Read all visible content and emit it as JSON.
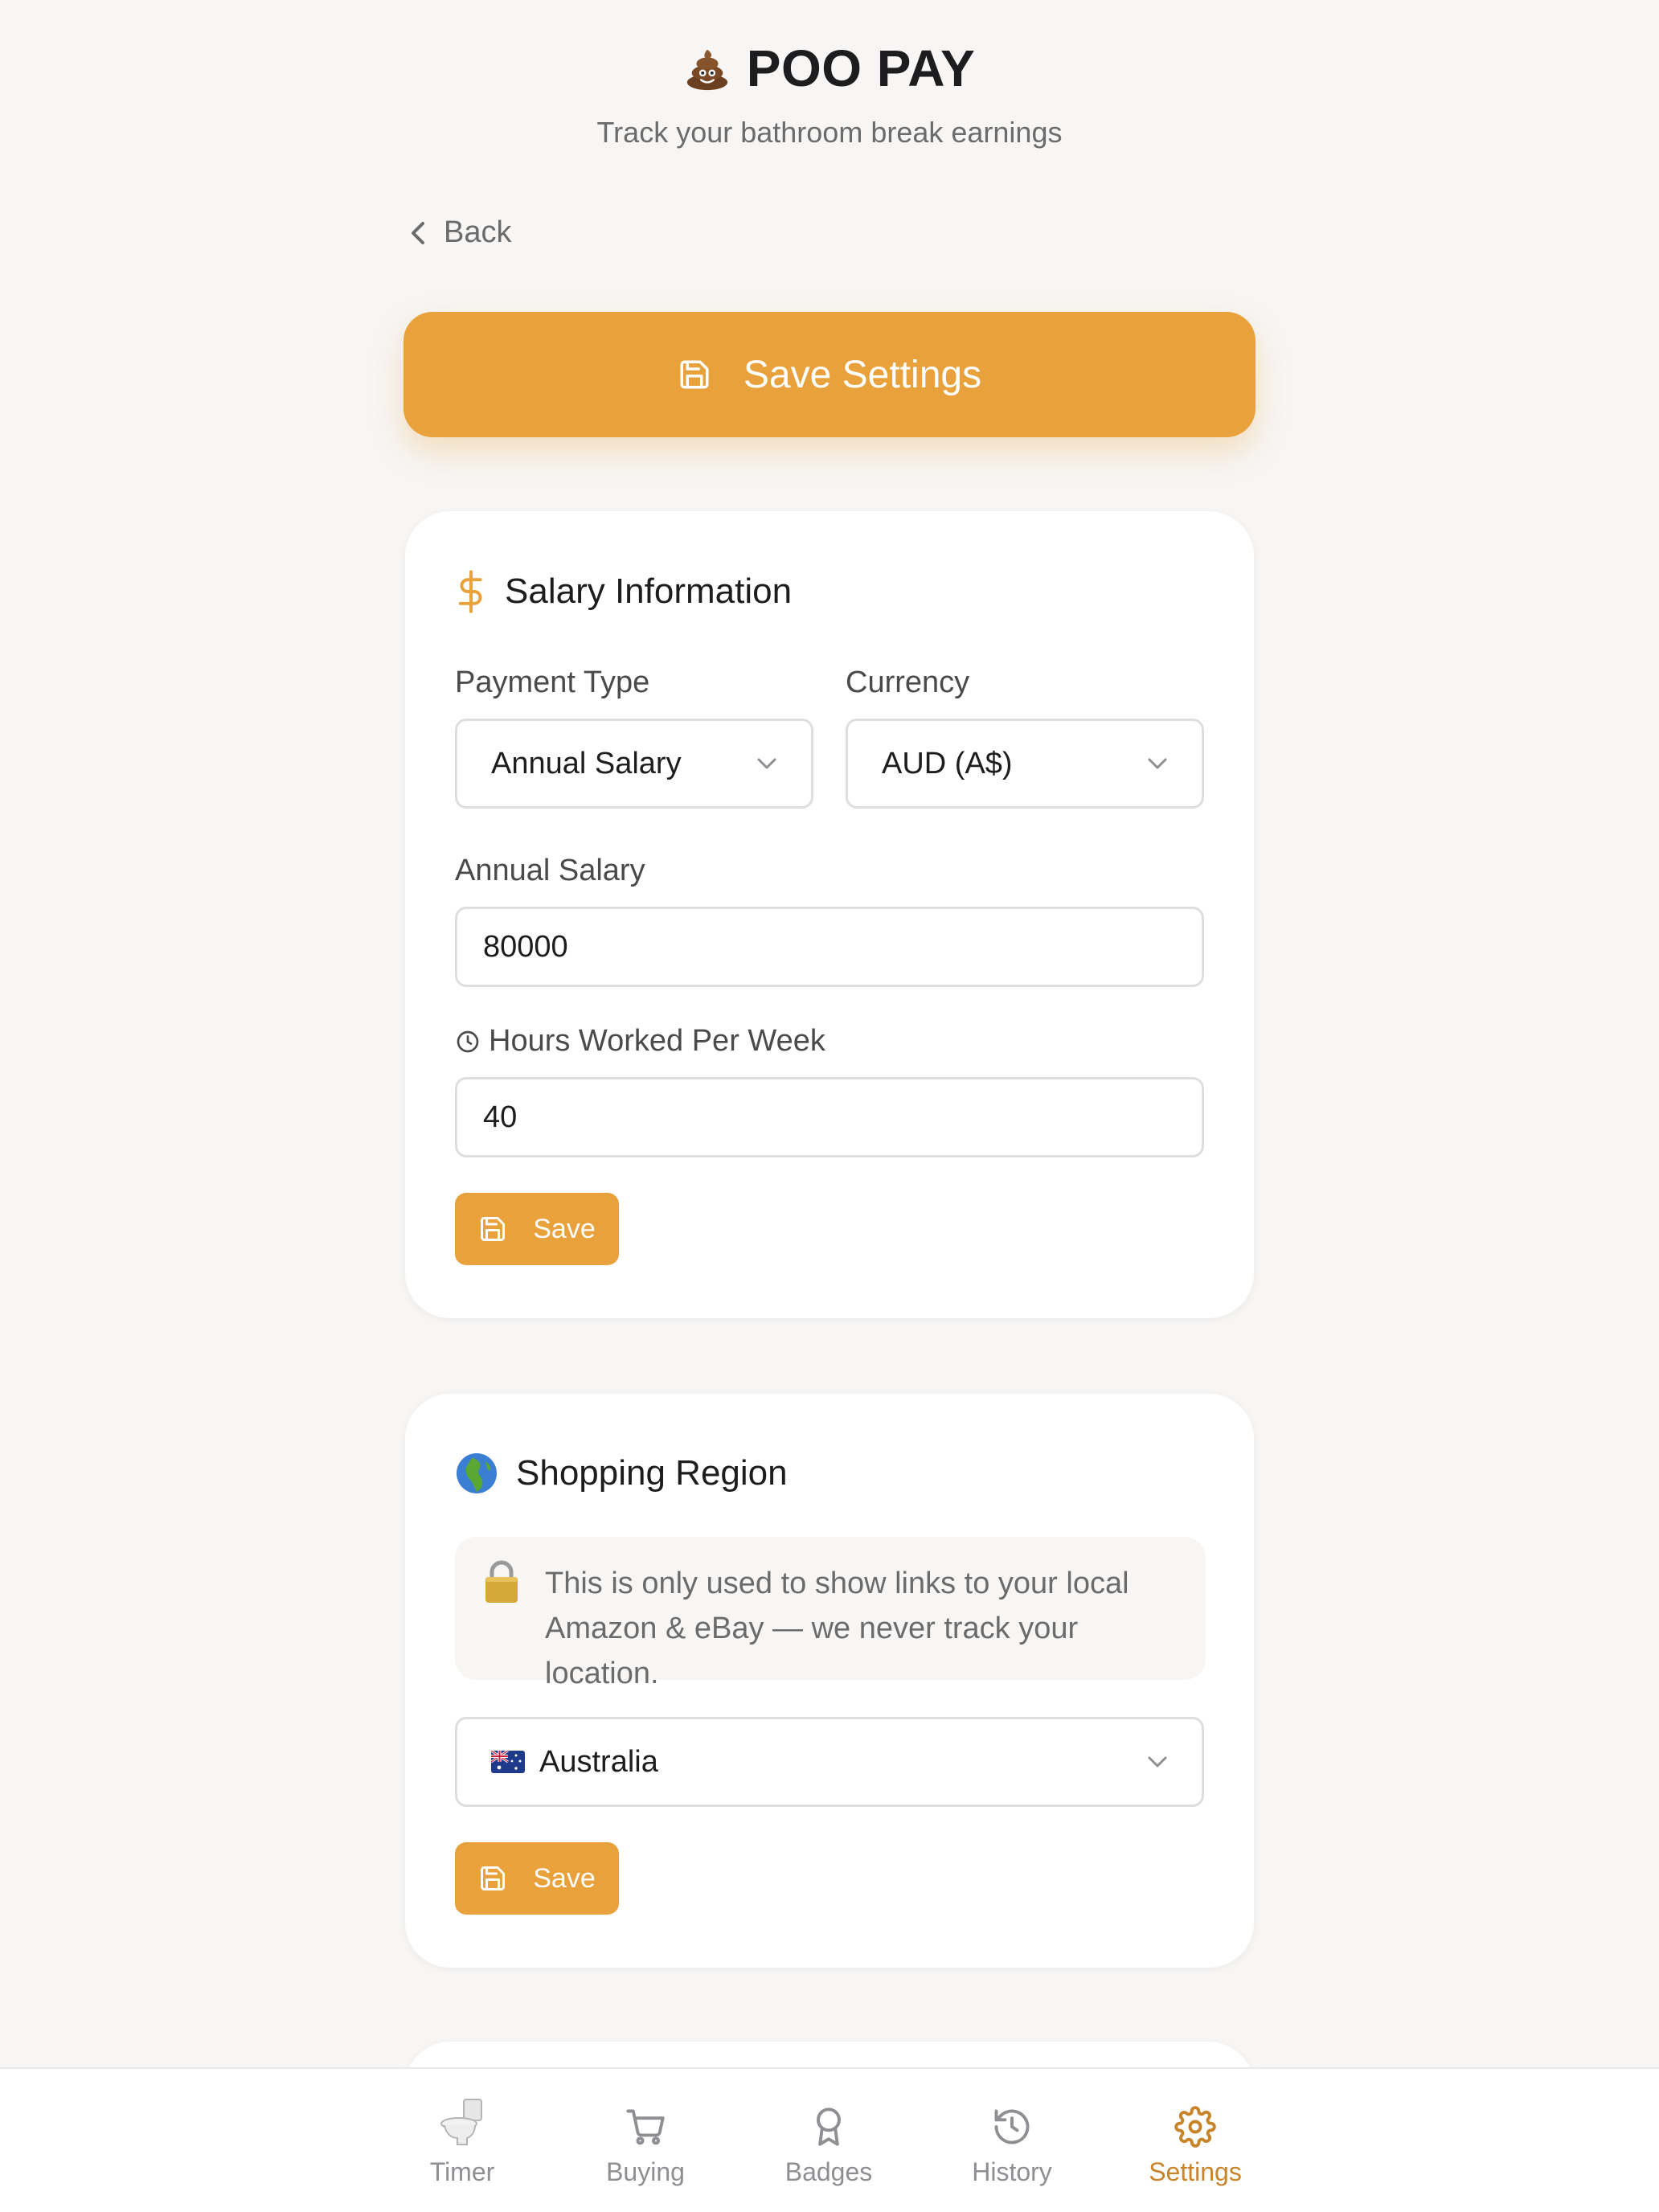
{
  "header": {
    "title": "POO PAY",
    "subtitle": "Track your bathroom break earnings"
  },
  "back": {
    "label": "Back"
  },
  "save_settings": {
    "label": "Save Settings"
  },
  "salary_card": {
    "title": "Salary Information",
    "payment_type": {
      "label": "Payment Type",
      "value": "Annual Salary"
    },
    "currency": {
      "label": "Currency",
      "value": "AUD (A$)"
    },
    "annual_salary": {
      "label": "Annual Salary",
      "value": "80000"
    },
    "hours": {
      "label": "Hours Worked Per Week",
      "value": "40"
    },
    "save_label": "Save"
  },
  "region_card": {
    "title": "Shopping Region",
    "notice": "This is only used to show links to your local Amazon & eBay — we never track your location.",
    "country": "Australia",
    "save_label": "Save"
  },
  "nav": {
    "items": [
      {
        "label": "Timer",
        "icon": "toilet-icon"
      },
      {
        "label": "Buying",
        "icon": "cart-icon"
      },
      {
        "label": "Badges",
        "icon": "award-icon"
      },
      {
        "label": "History",
        "icon": "history-icon"
      },
      {
        "label": "Settings",
        "icon": "gear-icon"
      }
    ],
    "active": "Settings"
  },
  "colors": {
    "accent": "#e9a23b",
    "accent_text": "#c8842a",
    "background": "#f7f6f5",
    "muted_text": "#6b6b6b"
  }
}
